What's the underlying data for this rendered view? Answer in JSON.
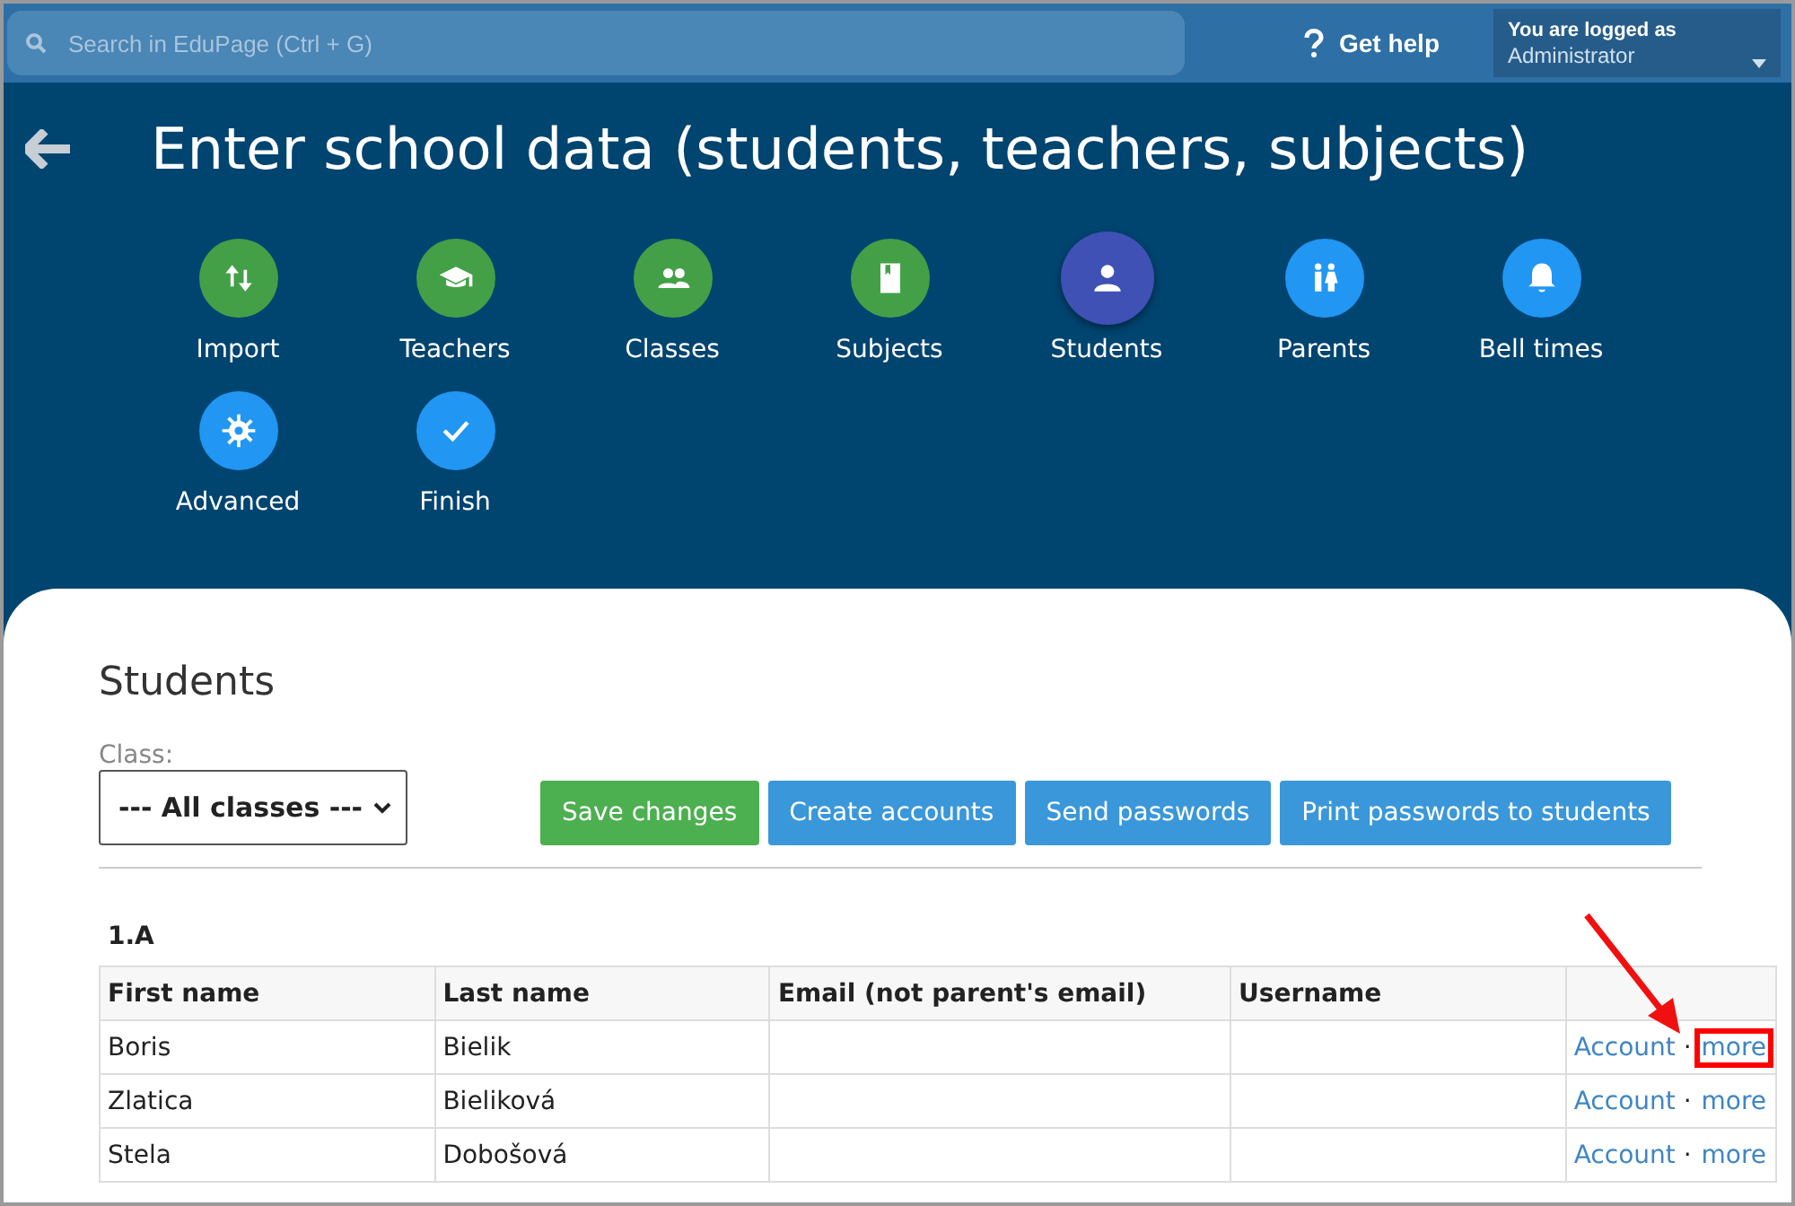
{
  "topbar": {
    "search": {
      "placeholder": "Search in EduPage (Ctrl + G)"
    },
    "help": "Get help",
    "login": {
      "caption": "You are logged as",
      "role": "Administrator"
    }
  },
  "header": {
    "title": "Enter school data (students, teachers, subjects)"
  },
  "steps": [
    {
      "label": "Import",
      "color": "#43a047",
      "selected": false
    },
    {
      "label": "Teachers",
      "color": "#43a047",
      "selected": false
    },
    {
      "label": "Classes",
      "color": "#43a047",
      "selected": false
    },
    {
      "label": "Subjects",
      "color": "#43a047",
      "selected": false
    },
    {
      "label": "Students",
      "color": "#3f51b5",
      "selected": true
    },
    {
      "label": "Parents",
      "color": "#2196f3",
      "selected": false
    },
    {
      "label": "Bell times",
      "color": "#2196f3",
      "selected": false
    },
    {
      "label": "Advanced",
      "color": "#2196f3",
      "selected": false
    },
    {
      "label": "Finish",
      "color": "#2196f3",
      "selected": false
    }
  ],
  "panel": {
    "title": "Students",
    "class_label": "Class:",
    "class_value": "--- All classes ---",
    "buttons": [
      {
        "label": "Save changes",
        "kind": "primary"
      },
      {
        "label": "Create accounts",
        "kind": "secondary"
      },
      {
        "label": "Send passwords",
        "kind": "secondary"
      },
      {
        "label": "Print passwords to students",
        "kind": "secondary"
      }
    ],
    "group": "1.A",
    "table": {
      "columns": [
        "First name",
        "Last name",
        "Email (not parent's email)",
        "Username"
      ],
      "rows": [
        {
          "first": "Boris",
          "last": "Bielik",
          "account": "Account",
          "sep": "·",
          "more": "more",
          "highlighted": true
        },
        {
          "first": "Zlatica",
          "last": "Bieliková",
          "account": "Account",
          "sep": "·",
          "more": "more",
          "highlighted": false
        },
        {
          "first": "Stela",
          "last": "Dobošová",
          "account": "Account",
          "sep": "·",
          "more": "more",
          "highlighted": false
        }
      ]
    }
  }
}
